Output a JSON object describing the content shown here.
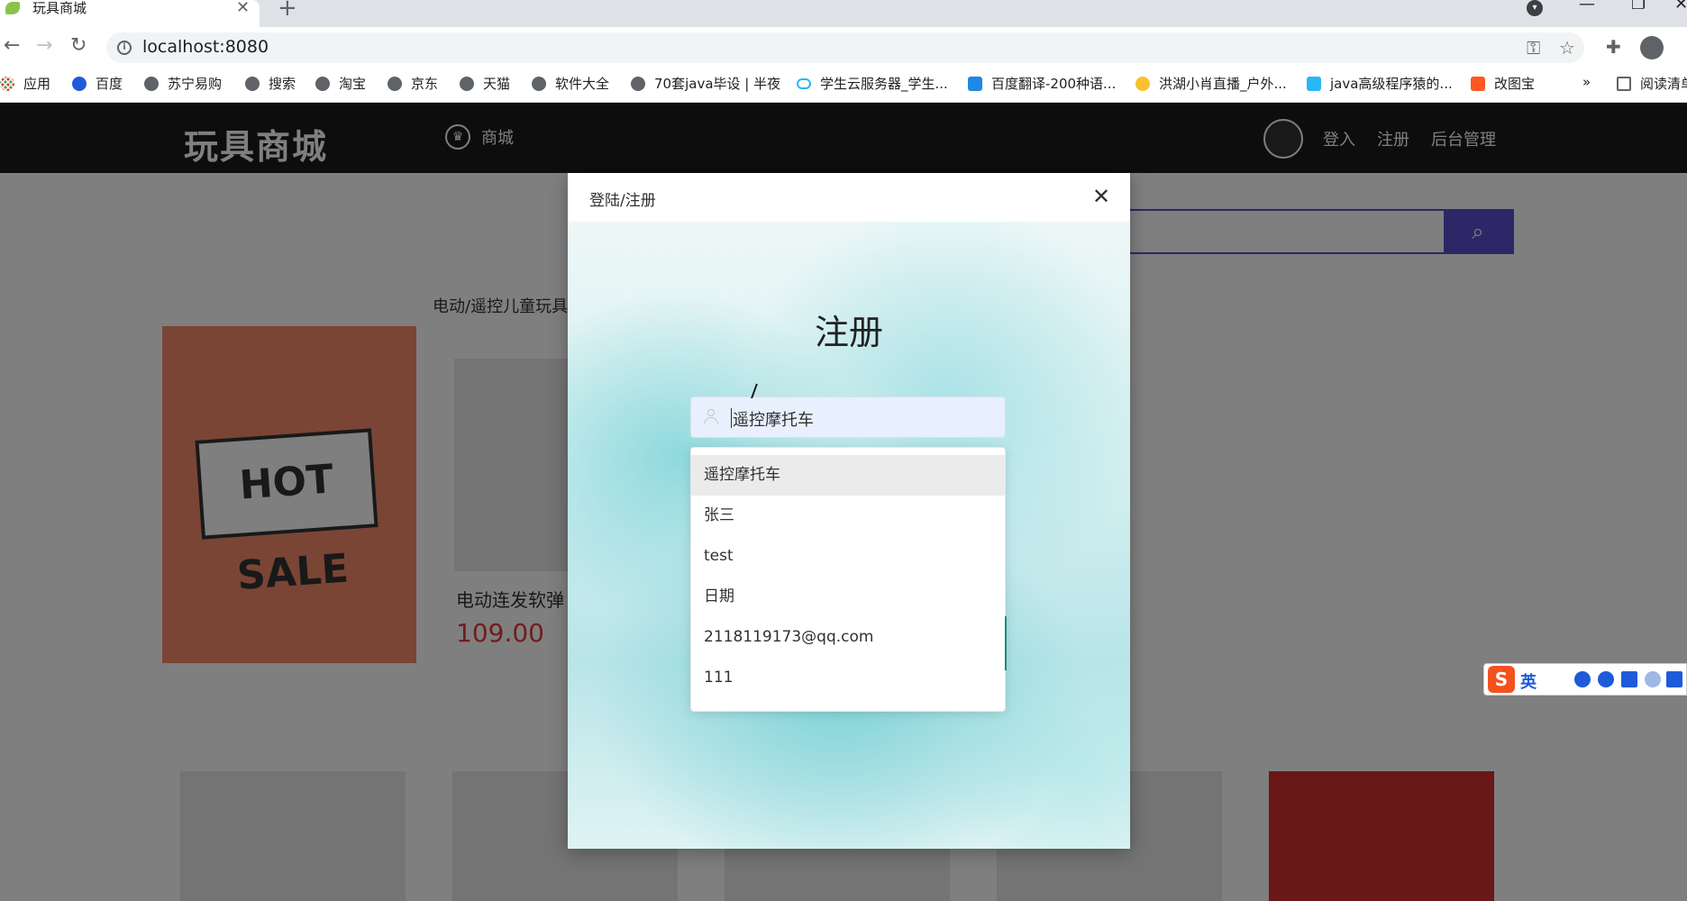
{
  "browser": {
    "tab_title": "玩具商城",
    "url": "localhost:8080",
    "bookmarks": [
      "应用",
      "百度",
      "苏宁易购",
      "搜索",
      "淘宝",
      "京东",
      "天猫",
      "软件大全",
      "70套java毕设 | 半夜",
      "学生云服务器_学生...",
      "百度翻译-200种语...",
      "洪湖小肖直播_户外...",
      "java高级程序猿的...",
      "改图宝",
      "阅读清单"
    ],
    "overflow_label": "»"
  },
  "site": {
    "logo": "玩具商城",
    "nav_mall": "商城",
    "login": "登入",
    "register": "注册",
    "admin": "后台管理",
    "category": "电动/遥控儿童玩具",
    "product": {
      "name": "电动连发软弹",
      "price": "109.00"
    },
    "hot_sale": "HOT SALE"
  },
  "modal": {
    "title": "登陆/注册",
    "heading": "注册",
    "input_value": "遥控摩托车",
    "suggestions": [
      "遥控摩托车",
      "张三",
      "test",
      "日期",
      "2118119173@qq.com",
      "111"
    ],
    "active_index": 0
  },
  "ime": {
    "logo": "S",
    "lang": "英"
  }
}
